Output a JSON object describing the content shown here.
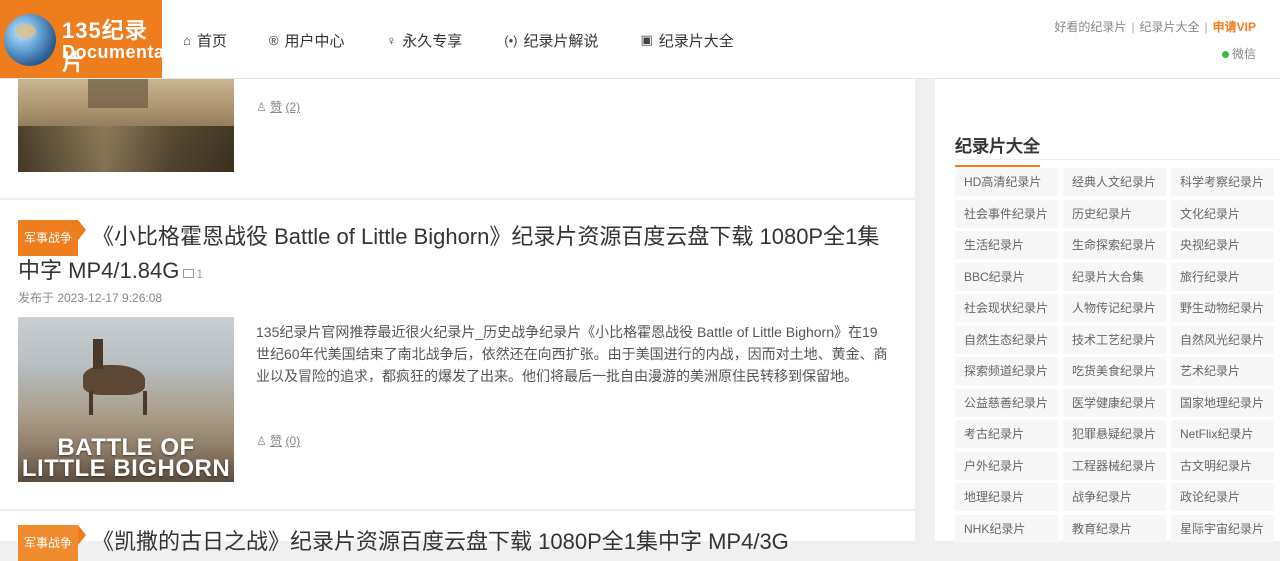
{
  "header": {
    "logo_cn": "135纪录片",
    "logo_en": "Documentary",
    "nav": [
      {
        "icon": "⌂",
        "label": "首页"
      },
      {
        "icon": "®",
        "label": "用户中心"
      },
      {
        "icon": "♀",
        "label": "永久专享"
      },
      {
        "icon": "(•)",
        "label": "纪录片解说"
      },
      {
        "icon": "▣",
        "label": "纪录片大全"
      }
    ],
    "top_links": [
      "好看的纪录片",
      "纪录片大全"
    ],
    "vip": "申请VIP",
    "wechat": "微信"
  },
  "prev_post": {
    "like_label": "赞",
    "like_count": "(2)"
  },
  "post": {
    "category": "军事战争",
    "title": "《小比格霍恩战役 Battle of Little Bighorn》纪录片资源百度云盘下载 1080P全1集中字 MP4/1.84G",
    "image_count": "1",
    "date": "发布于 2023-12-17 9:26:08",
    "thumb_text_1": "BATTLE OF",
    "thumb_text_2": "LITTLE BIGHORN",
    "excerpt": "135纪录片官网推荐最近很火纪录片_历史战争纪录片《小比格霍恩战役 Battle of Little Bighorn》在19世纪60年代美国结束了南北战争后，依然还在向西扩张。由于美国进行的内战，因而对土地、黄金、商业以及冒险的追求，都疯狂的爆发了出来。他们将最后一批自由漫游的美洲原住民转移到保留地。",
    "like_label": "赞",
    "like_count": "(0)"
  },
  "next_post": {
    "category": "军事战争",
    "title": "《凯撒的古日之战》纪录片资源百度云盘下载 1080P全1集中字 MP4/3G"
  },
  "sidebar": {
    "title": "纪录片大全",
    "tags": [
      "HD高清纪录片",
      "经典人文纪录片",
      "科学考察纪录片",
      "社会事件纪录片",
      "历史纪录片",
      "文化纪录片",
      "生活纪录片",
      "生命探索纪录片",
      "央视纪录片",
      "BBC纪录片",
      "纪录片大合集",
      "旅行纪录片",
      "社会现状纪录片",
      "人物传记纪录片",
      "野生动物纪录片",
      "自然生态纪录片",
      "技术工艺纪录片",
      "自然风光纪录片",
      "探索频道纪录片",
      "吃货美食纪录片",
      "艺术纪录片",
      "公益慈善纪录片",
      "医学健康纪录片",
      "国家地理纪录片",
      "考古纪录片",
      "犯罪悬疑纪录片",
      "NetFlix纪录片",
      "户外纪录片",
      "工程器械纪录片",
      "古文明纪录片",
      "地理纪录片",
      "战争纪录片",
      "政论纪录片",
      "NHK纪录片",
      "教育纪录片",
      "星际宇宙纪录片"
    ]
  },
  "colors": {
    "accent": "#ee7d1d",
    "wechat_dot": "#3ab54a"
  }
}
